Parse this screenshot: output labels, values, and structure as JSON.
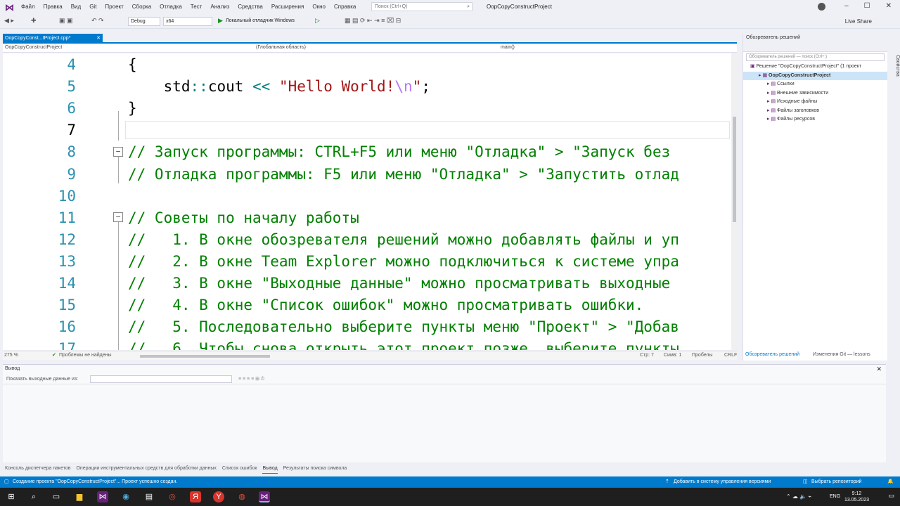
{
  "titlebar": {
    "menu": [
      "Файл",
      "Правка",
      "Вид",
      "Git",
      "Проект",
      "Сборка",
      "Отладка",
      "Тест",
      "Анализ",
      "Средства",
      "Расширения",
      "Окно",
      "Справка"
    ],
    "search_placeholder": "Поиск (Ctrl+Q)",
    "window_title": "OopCopyConstructProject"
  },
  "toolbar": {
    "config": "Debug",
    "platform": "x64",
    "run_label": "Локальный отладчик Windows",
    "live_share": "Live Share"
  },
  "tabs": {
    "active": "OopCopyConst...tProject.cpp*"
  },
  "navbar": {
    "project": "OopCopyConstructProject",
    "scope": "(Глобальная область)",
    "function": "main()"
  },
  "editor": {
    "lines": [
      {
        "n": "4",
        "text": "{"
      },
      {
        "n": "5",
        "parts": [
          [
            "",
            "    std"
          ],
          [
            "op",
            "::"
          ],
          [
            "",
            "cout "
          ],
          [
            "op",
            "<<"
          ],
          [
            "",
            " "
          ],
          [
            "str",
            "\"Hello World!"
          ],
          [
            "esc",
            "\\n"
          ],
          [
            "str",
            "\""
          ],
          [
            "",
            ";"
          ]
        ]
      },
      {
        "n": "6",
        "text": "}"
      },
      {
        "n": "7",
        "text": ""
      },
      {
        "n": "8",
        "cm": "// Запуск программы: CTRL+F5 или меню \"Отладка\" > \"Запуск без"
      },
      {
        "n": "9",
        "cm": "// Отладка программы: F5 или меню \"Отладка\" > \"Запустить отлад"
      },
      {
        "n": "10",
        "text": ""
      },
      {
        "n": "11",
        "cm": "// Советы по началу работы"
      },
      {
        "n": "12",
        "cm": "//   1. В окне обозревателя решений можно добавлять файлы и уп"
      },
      {
        "n": "13",
        "cm": "//   2. В окне Team Explorer можно подключиться к системе упра"
      },
      {
        "n": "14",
        "cm": "//   3. В окне \"Выходные данные\" можно просматривать выходные"
      },
      {
        "n": "15",
        "cm": "//   4. В окне \"Список ошибок\" можно просматривать ошибки."
      },
      {
        "n": "16",
        "cm": "//   5. Последовательно выберите пункты меню \"Проект\" > \"Добав"
      },
      {
        "n": "17",
        "cm": "//   6. Чтобы снова открыть этот проект позже, выберите пункты"
      }
    ]
  },
  "editor_status": {
    "zoom": "275 %",
    "problems": "Проблемы не найдены",
    "line": "Стр: 7",
    "col": "Симв: 1",
    "spaces": "Пробелы",
    "eol": "CRLF"
  },
  "solution": {
    "title": "Обозреватель решений",
    "search_placeholder": "Обозреватель решений — поиск (Ctrl+;)",
    "tree": [
      {
        "label": "Решение \"OopCopyConstructProject\" (1 проект",
        "indent": 0
      },
      {
        "label": "OopCopyConstructProject",
        "indent": 1,
        "selected": true
      },
      {
        "label": "Ссылки",
        "indent": 2
      },
      {
        "label": "Внешние зависимости",
        "indent": 2
      },
      {
        "label": "Исходные файлы",
        "indent": 2
      },
      {
        "label": "Файлы заголовков",
        "indent": 2
      },
      {
        "label": "Файлы ресурсов",
        "indent": 2
      }
    ],
    "bottom_tabs": [
      "Обозреватель решений",
      "Изменения Git — lessons"
    ],
    "side_strip": "Свойства"
  },
  "output": {
    "title": "Вывод",
    "show_from": "Показать выходные данные из:"
  },
  "bottom_tabs": [
    "Консоль диспетчера пакетов",
    "Операции инструментальных средств для обработки данных",
    "Список ошибок",
    "Вывод",
    "Результаты поиска символа"
  ],
  "bottom_tab_active": "Вывод",
  "statusbar": {
    "message": "Создание проекта \"OopCopyConstructProject\"... Проект успешно создан.",
    "vcs": "Добавить в систему управления версиями",
    "repo": "Выбрать репозиторий"
  },
  "taskbar": {
    "lang": "ENG",
    "time": "9:12",
    "date": "13.05.2023"
  },
  "colors": {
    "accent": "#007acc",
    "comment": "#008000",
    "string": "#a31515",
    "linenumber": "#2b91af"
  }
}
